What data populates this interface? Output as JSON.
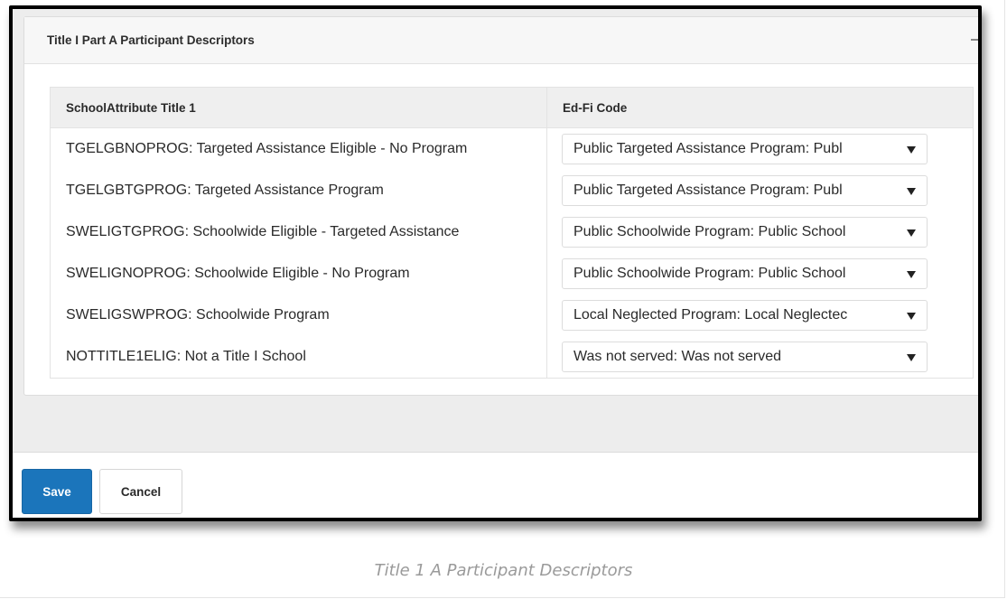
{
  "panel": {
    "title": "Title I Part A Participant Descriptors",
    "collapse_icon": "minus-icon"
  },
  "table": {
    "headers": [
      "SchoolAttribute Title 1",
      "Ed-Fi Code"
    ],
    "rows": [
      {
        "attribute": "TGELGBNOPROG: Targeted Assistance Eligible - No Program",
        "code": "Public Targeted Assistance Program: Publ"
      },
      {
        "attribute": "TGELGBTGPROG: Targeted Assistance Program",
        "code": "Public Targeted Assistance Program: Publ"
      },
      {
        "attribute": "SWELIGTGPROG: Schoolwide Eligible - Targeted Assistance",
        "code": "Public Schoolwide Program: Public School"
      },
      {
        "attribute": "SWELIGNOPROG: Schoolwide Eligible - No Program",
        "code": "Public Schoolwide Program: Public School"
      },
      {
        "attribute": "SWELIGSWPROG: Schoolwide Program",
        "code": "Local Neglected Program: Local Neglectec"
      },
      {
        "attribute": "NOTTITLE1ELIG: Not a Title I School",
        "code": "Was not served: Was not served"
      }
    ]
  },
  "footer": {
    "save_label": "Save",
    "cancel_label": "Cancel"
  },
  "caption": "Title 1 A Participant Descriptors",
  "colors": {
    "primary_button": "#1b75bb",
    "header_bg": "#efefef"
  }
}
